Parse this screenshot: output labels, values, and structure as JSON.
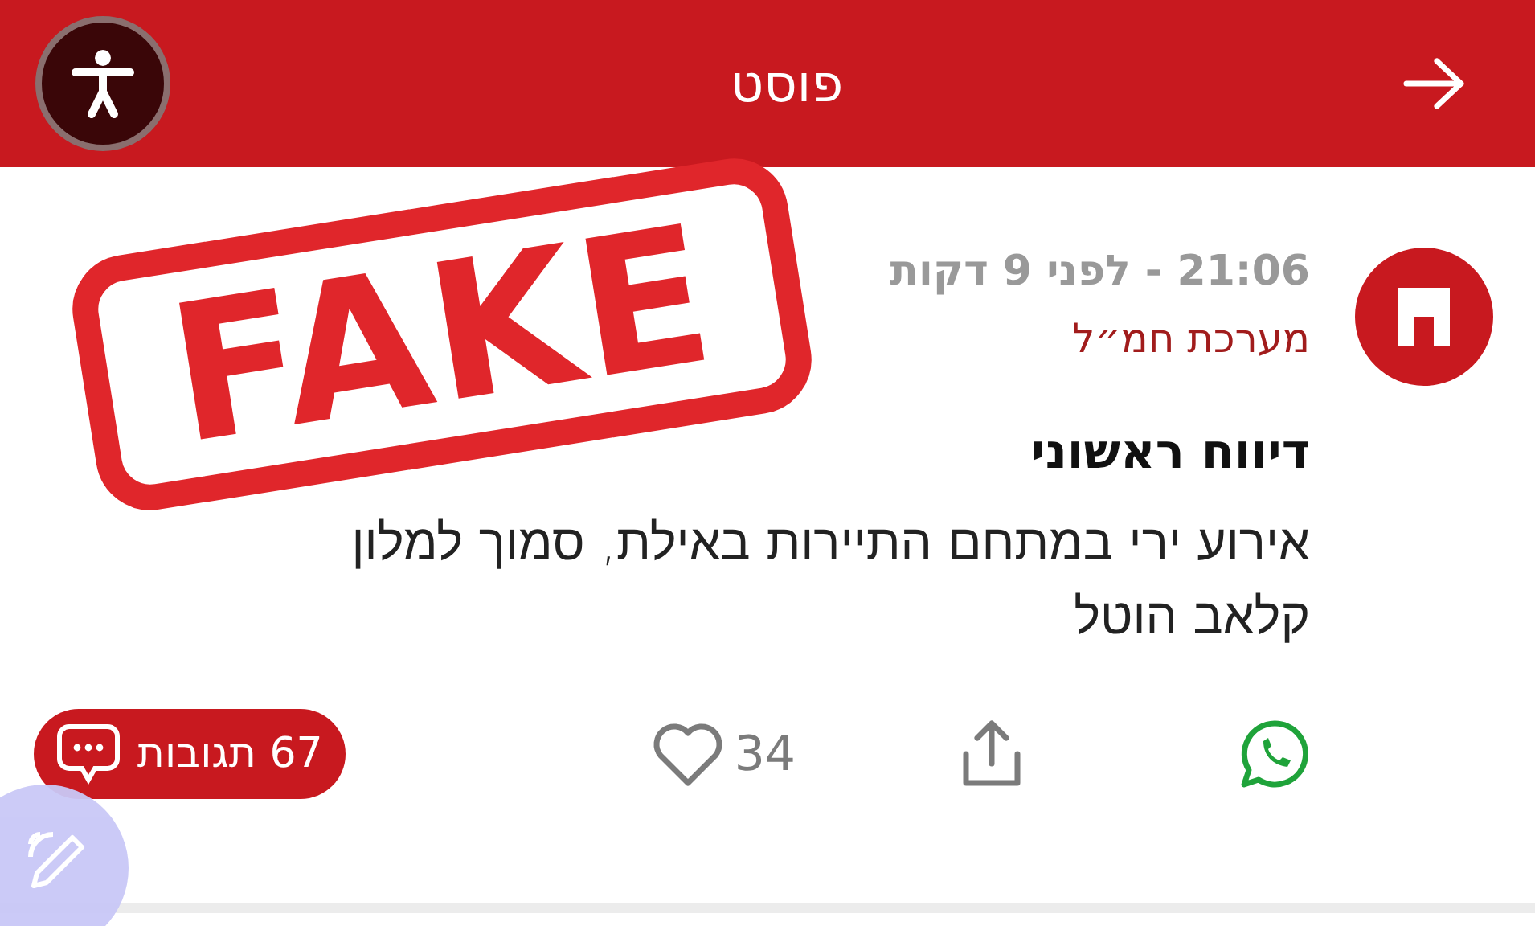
{
  "header": {
    "title": "פוסט"
  },
  "post": {
    "time": "21:06 - לפני 9 דקות",
    "author": "מערכת חמ״ל",
    "headline": "דיווח ראשוני",
    "body": "אירוע ירי במתחם התיירות באילת, סמוך למלון קלאב הוטל",
    "likes": "34",
    "comments": "67 תגובות"
  },
  "stamp": {
    "text": "FAKE"
  }
}
